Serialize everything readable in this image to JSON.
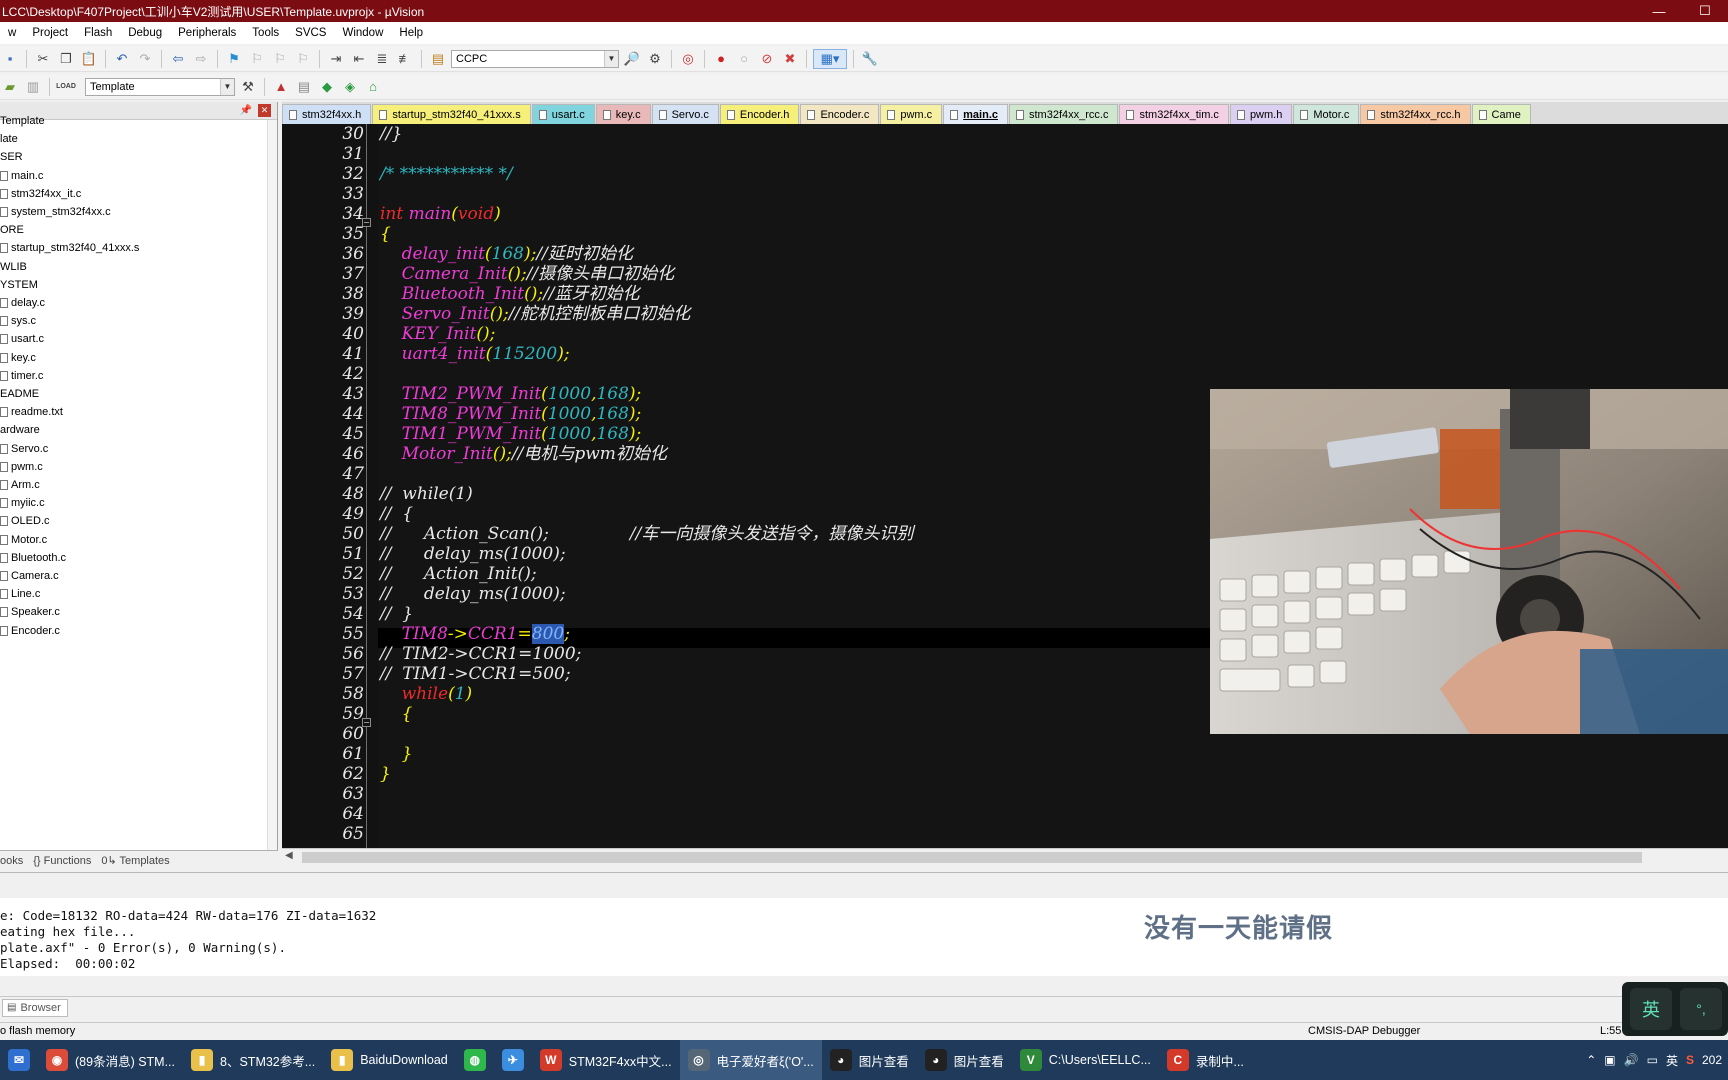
{
  "window": {
    "title": "LCC\\Desktop\\F407Project\\工训小车V2测试用\\USER\\Template.uvprojx - µVision"
  },
  "menu": [
    "w",
    "Project",
    "Flash",
    "Debug",
    "Peripherals",
    "Tools",
    "SVCS",
    "Window",
    "Help"
  ],
  "toolbar": {
    "target_combo": "CCPC",
    "project_combo": "Template",
    "load_label": "LOAD"
  },
  "project_tree": [
    {
      "label": "Template",
      "file": false
    },
    {
      "label": "late",
      "file": false
    },
    {
      "label": "SER",
      "file": false
    },
    {
      "label": "main.c",
      "file": true
    },
    {
      "label": "stm32f4xx_it.c",
      "file": true
    },
    {
      "label": "system_stm32f4xx.c",
      "file": true
    },
    {
      "label": "ORE",
      "file": false
    },
    {
      "label": "startup_stm32f40_41xxx.s",
      "file": true
    },
    {
      "label": "WLIB",
      "file": false
    },
    {
      "label": "YSTEM",
      "file": false
    },
    {
      "label": "delay.c",
      "file": true
    },
    {
      "label": "sys.c",
      "file": true
    },
    {
      "label": "usart.c",
      "file": true
    },
    {
      "label": "key.c",
      "file": true
    },
    {
      "label": "timer.c",
      "file": true
    },
    {
      "label": "EADME",
      "file": false
    },
    {
      "label": "readme.txt",
      "file": true
    },
    {
      "label": "ardware",
      "file": false
    },
    {
      "label": "Servo.c",
      "file": true
    },
    {
      "label": "pwm.c",
      "file": true
    },
    {
      "label": "Arm.c",
      "file": true
    },
    {
      "label": "myiic.c",
      "file": true
    },
    {
      "label": "OLED.c",
      "file": true
    },
    {
      "label": "Motor.c",
      "file": true
    },
    {
      "label": "Bluetooth.c",
      "file": true
    },
    {
      "label": "Camera.c",
      "file": true
    },
    {
      "label": "Line.c",
      "file": true
    },
    {
      "label": "Speaker.c",
      "file": true
    },
    {
      "label": "Encoder.c",
      "file": true
    }
  ],
  "project_tabs": [
    "ooks",
    "{} Functions",
    "0↳ Templates"
  ],
  "editor_tabs": [
    {
      "label": "stm32f4xx.h",
      "color": "#cfe0f6"
    },
    {
      "label": "startup_stm32f40_41xxx.s",
      "color": "#f6f07a"
    },
    {
      "label": "usart.c",
      "color": "#7fd4dd"
    },
    {
      "label": "key.c",
      "color": "#e9b8b8"
    },
    {
      "label": "Servo.c",
      "color": "#d4e2f4"
    },
    {
      "label": "Encoder.h",
      "color": "#f6f07a"
    },
    {
      "label": "Encoder.c",
      "color": "#f2e7c2"
    },
    {
      "label": "pwm.c",
      "color": "#f6f0a2"
    },
    {
      "label": "main.c",
      "color": "#e4ecf8",
      "active": true
    },
    {
      "label": "stm32f4xx_rcc.c",
      "color": "#cfe6cf"
    },
    {
      "label": "stm32f4xx_tim.c",
      "color": "#f4d0e4"
    },
    {
      "label": "pwm.h",
      "color": "#dcd0f2"
    },
    {
      "label": "Motor.c",
      "color": "#cfe6dc"
    },
    {
      "label": "stm32f4xx_rcc.h",
      "color": "#f6c8a4"
    },
    {
      "label": "Came",
      "color": "#e0f2c2"
    }
  ],
  "code": [
    {
      "n": "30",
      "parts": [
        [
          "c-cm",
          "//}"
        ]
      ]
    },
    {
      "n": "31",
      "parts": []
    },
    {
      "n": "32",
      "parts": [
        [
          "c-num",
          "/* *********** */"
        ]
      ]
    },
    {
      "n": "33",
      "parts": []
    },
    {
      "n": "34",
      "parts": [
        [
          "c-kw",
          "int"
        ],
        [
          "c-cm",
          " "
        ],
        [
          "c-fn",
          "main"
        ],
        [
          "c-pu",
          "("
        ],
        [
          "c-kw",
          "void"
        ],
        [
          "c-pu",
          ")"
        ]
      ]
    },
    {
      "n": "35",
      "parts": [
        [
          "c-pu",
          "{"
        ]
      ]
    },
    {
      "n": "36",
      "parts": [
        [
          "c-cm",
          "    "
        ],
        [
          "c-fn",
          "delay_init"
        ],
        [
          "c-pu",
          "("
        ],
        [
          "c-num",
          "168"
        ],
        [
          "c-pu",
          ");"
        ],
        [
          "c-cm",
          "//延时初始化"
        ]
      ]
    },
    {
      "n": "37",
      "parts": [
        [
          "c-cm",
          "    "
        ],
        [
          "c-fn",
          "Camera_Init"
        ],
        [
          "c-pu",
          "();"
        ],
        [
          "c-cm",
          "//摄像头串口初始化"
        ]
      ]
    },
    {
      "n": "38",
      "parts": [
        [
          "c-cm",
          "    "
        ],
        [
          "c-fn",
          "Bluetooth_Init"
        ],
        [
          "c-pu",
          "();"
        ],
        [
          "c-cm",
          "//蓝牙初始化"
        ]
      ]
    },
    {
      "n": "39",
      "parts": [
        [
          "c-cm",
          "    "
        ],
        [
          "c-fn",
          "Servo_Init"
        ],
        [
          "c-pu",
          "();"
        ],
        [
          "c-cm",
          "//舵机控制板串口初始化"
        ]
      ]
    },
    {
      "n": "40",
      "parts": [
        [
          "c-cm",
          "    "
        ],
        [
          "c-fn",
          "KEY_Init"
        ],
        [
          "c-pu",
          "();"
        ]
      ]
    },
    {
      "n": "41",
      "parts": [
        [
          "c-cm",
          "    "
        ],
        [
          "c-fn",
          "uart4_init"
        ],
        [
          "c-pu",
          "("
        ],
        [
          "c-num",
          "115200"
        ],
        [
          "c-pu",
          ");"
        ]
      ]
    },
    {
      "n": "42",
      "parts": []
    },
    {
      "n": "43",
      "parts": [
        [
          "c-cm",
          "    "
        ],
        [
          "c-fn",
          "TIM2_PWM_Init"
        ],
        [
          "c-pu",
          "("
        ],
        [
          "c-num",
          "1000"
        ],
        [
          "c-pu",
          ","
        ],
        [
          "c-num",
          "168"
        ],
        [
          "c-pu",
          ");"
        ]
      ]
    },
    {
      "n": "44",
      "parts": [
        [
          "c-cm",
          "    "
        ],
        [
          "c-fn",
          "TIM8_PWM_Init"
        ],
        [
          "c-pu",
          "("
        ],
        [
          "c-num",
          "1000"
        ],
        [
          "c-pu",
          ","
        ],
        [
          "c-num",
          "168"
        ],
        [
          "c-pu",
          ");"
        ]
      ]
    },
    {
      "n": "45",
      "parts": [
        [
          "c-cm",
          "    "
        ],
        [
          "c-fn",
          "TIM1_PWM_Init"
        ],
        [
          "c-pu",
          "("
        ],
        [
          "c-num",
          "1000"
        ],
        [
          "c-pu",
          ","
        ],
        [
          "c-num",
          "168"
        ],
        [
          "c-pu",
          ");"
        ]
      ]
    },
    {
      "n": "46",
      "parts": [
        [
          "c-cm",
          "    "
        ],
        [
          "c-fn",
          "Motor_Init"
        ],
        [
          "c-pu",
          "();"
        ],
        [
          "c-cm",
          "//电机与pwm初始化"
        ]
      ]
    },
    {
      "n": "47",
      "parts": []
    },
    {
      "n": "48",
      "parts": [
        [
          "c-cm",
          "//  while(1)"
        ]
      ]
    },
    {
      "n": "49",
      "parts": [
        [
          "c-cm",
          "//  {"
        ]
      ]
    },
    {
      "n": "50",
      "parts": [
        [
          "c-cm",
          "//      Action_Scan();               //车一向摄像头发送指令，摄像头识别"
        ]
      ]
    },
    {
      "n": "51",
      "parts": [
        [
          "c-cm",
          "//      delay_ms(1000);"
        ]
      ]
    },
    {
      "n": "52",
      "parts": [
        [
          "c-cm",
          "//      Action_Init();"
        ]
      ]
    },
    {
      "n": "53",
      "parts": [
        [
          "c-cm",
          "//      delay_ms(1000);"
        ]
      ]
    },
    {
      "n": "54",
      "parts": [
        [
          "c-cm",
          "//  }"
        ]
      ]
    },
    {
      "n": "55",
      "parts": [
        [
          "c-cm",
          "    "
        ],
        [
          "c-id",
          "TIM8"
        ],
        [
          "c-pu",
          "->"
        ],
        [
          "c-id",
          "CCR1"
        ],
        [
          "c-pu",
          "="
        ],
        [
          "sel",
          "800"
        ],
        [
          "c-pu",
          ";"
        ]
      ]
    },
    {
      "n": "56",
      "parts": [
        [
          "c-cm",
          "//  TIM2->CCR1=1000;"
        ]
      ]
    },
    {
      "n": "57",
      "parts": [
        [
          "c-cm",
          "//  TIM1->CCR1=500;"
        ]
      ]
    },
    {
      "n": "58",
      "parts": [
        [
          "c-cm",
          "    "
        ],
        [
          "c-kw",
          "while"
        ],
        [
          "c-pu",
          "("
        ],
        [
          "c-num",
          "1"
        ],
        [
          "c-pu",
          ")"
        ]
      ]
    },
    {
      "n": "59",
      "parts": [
        [
          "c-cm",
          "    "
        ],
        [
          "c-pu",
          "{"
        ]
      ]
    },
    {
      "n": "60",
      "parts": []
    },
    {
      "n": "61",
      "parts": [
        [
          "c-cm",
          "    "
        ],
        [
          "c-pu",
          "}"
        ]
      ]
    },
    {
      "n": "62",
      "parts": [
        [
          "c-pu",
          "}"
        ]
      ]
    },
    {
      "n": "63",
      "parts": []
    },
    {
      "n": "64",
      "parts": []
    },
    {
      "n": "65",
      "parts": []
    }
  ],
  "build_output": [
    "e: Code=18132 RO-data=424 RW-data=176 ZI-data=1632",
    "eating hex file...",
    "plate.axf\" - 0 Error(s), 0 Warning(s).",
    "Elapsed:  00:00:02"
  ],
  "watermark": "没有一天能请假",
  "build_tab": "Browser",
  "status": {
    "left": "o flash memory",
    "debugger": "CMSIS-DAP Debugger",
    "position": "L:55 C:"
  },
  "ime": {
    "lang": "英",
    "punct": "°,"
  },
  "taskbar": [
    {
      "label": "",
      "icon": "✉",
      "color": "#2f6fd0"
    },
    {
      "label": "(89条消息) STM...",
      "icon": "◉",
      "color": "#dd4b39"
    },
    {
      "label": "8、STM32参考...",
      "icon": "▮",
      "color": "#e8c04a"
    },
    {
      "label": "BaiduDownload",
      "icon": "▮",
      "color": "#e8c04a"
    },
    {
      "label": "",
      "icon": "◍",
      "color": "#2eb84b"
    },
    {
      "label": "",
      "icon": "✈",
      "color": "#3b8de0"
    },
    {
      "label": "STM32F4xx中文...",
      "icon": "W",
      "color": "#d43a2a"
    },
    {
      "label": "电子爱好者ξ('Ο'...",
      "icon": "◎",
      "color": "#556677",
      "active": true
    },
    {
      "label": "图片查看",
      "icon": "◕",
      "color": "#222222"
    },
    {
      "label": "图片查看",
      "icon": "◕",
      "color": "#222222"
    },
    {
      "label": "C:\\Users\\EELLC...",
      "icon": "V",
      "color": "#2e8a3a"
    },
    {
      "label": "录制中...",
      "icon": "C",
      "color": "#d43a2a"
    }
  ],
  "tray": {
    "ime": "英",
    "year": "202"
  }
}
